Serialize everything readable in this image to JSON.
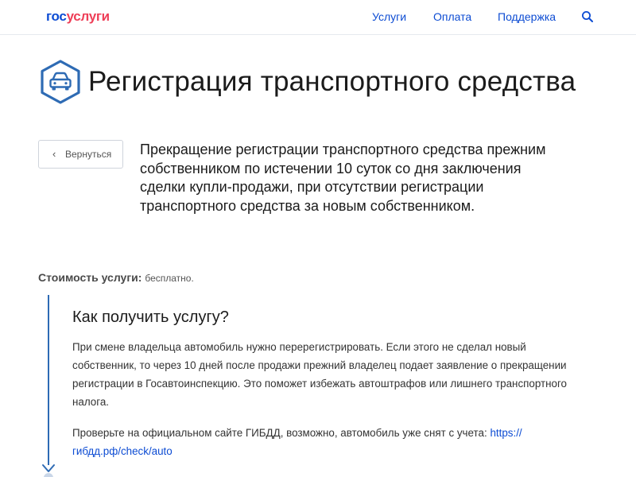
{
  "header": {
    "logo_gos": "гос",
    "logo_uslugi": "услуги",
    "nav": {
      "services": "Услуги",
      "payment": "Оплата",
      "support": "Поддержка"
    }
  },
  "page": {
    "title": "Регистрация транспортного средства",
    "back_label": "Вернуться",
    "service_description": "Прекращение регистрации транспортного средства прежним собственником по истечении 10 суток со дня заключения сделки купли-продажи, при отсутствии регистрации транспортного средства за новым собственником."
  },
  "cost": {
    "label": "Стоимость услуги:",
    "value": "бесплатно."
  },
  "how_to": {
    "heading": "Как получить услугу?",
    "paragraph1": "При смене владельца автомобиль нужно перерегистрировать. Если этого не сделал новый собственник, то через 10 дней после продажи прежний владелец подает заявление о прекращении регистрации в Госавтоинспекцию. Это поможет избежать автоштрафов или лишнего транспортного налога.",
    "paragraph2_text": "Проверьте на официальном сайте ГИБДД, возможно, автомобиль уже снят с учета:",
    "paragraph2_link": "https:// гибдд.рф/check/auto"
  },
  "colors": {
    "brand_blue": "#0d4cd3",
    "brand_red": "#ee3f58",
    "timeline_blue": "#2e6bb4"
  },
  "icons": {
    "search": "search-icon",
    "title": "car-icon",
    "back": "chevron-left-icon"
  }
}
